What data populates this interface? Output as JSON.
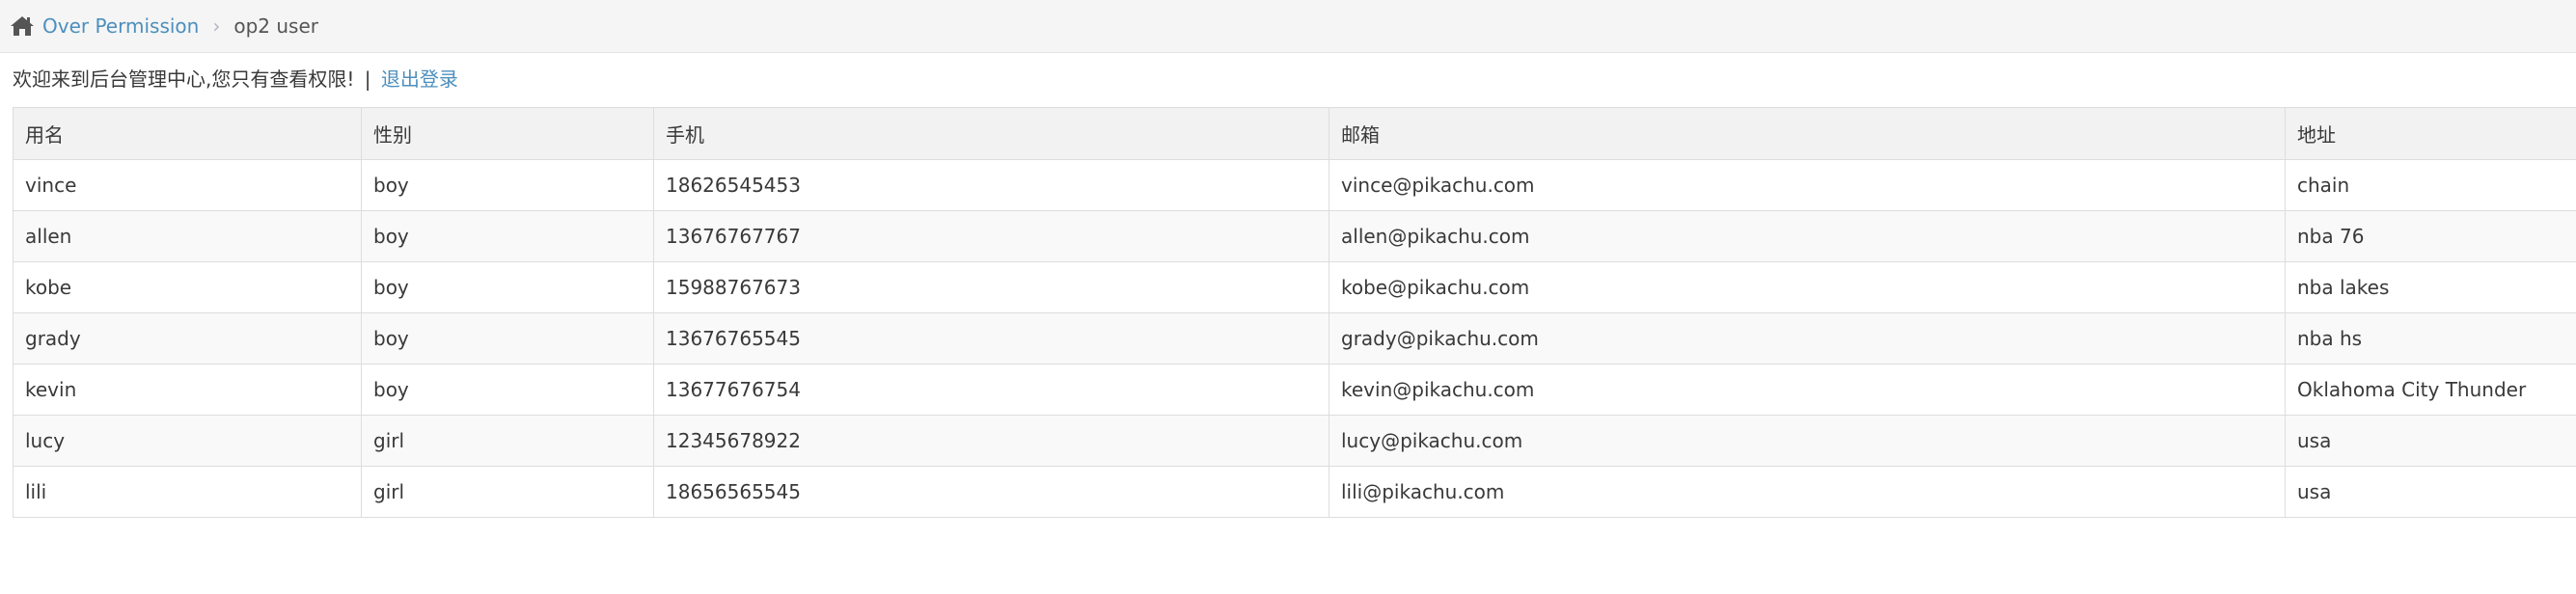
{
  "breadcrumb": {
    "home_icon": "home-icon",
    "parent": "Over Permission",
    "current": "op2 user"
  },
  "welcome": {
    "message": "欢迎来到后台管理中心,您只有查看权限!",
    "separator": "|",
    "logout": "退出登录"
  },
  "table": {
    "headers": [
      "用名",
      "性别",
      "手机",
      "邮箱",
      "地址"
    ],
    "rows": [
      [
        "vince",
        "boy",
        "18626545453",
        "vince@pikachu.com",
        "chain"
      ],
      [
        "allen",
        "boy",
        "13676767767",
        "allen@pikachu.com",
        "nba 76"
      ],
      [
        "kobe",
        "boy",
        "15988767673",
        "kobe@pikachu.com",
        "nba lakes"
      ],
      [
        "grady",
        "boy",
        "13676765545",
        "grady@pikachu.com",
        "nba hs"
      ],
      [
        "kevin",
        "boy",
        "13677676754",
        "kevin@pikachu.com",
        "Oklahoma City Thunder"
      ],
      [
        "lucy",
        "girl",
        "12345678922",
        "lucy@pikachu.com",
        "usa"
      ],
      [
        "lili",
        "girl",
        "18656565545",
        "lili@pikachu.com",
        "usa"
      ]
    ]
  },
  "colors": {
    "link": "#4c8fbd",
    "breadcrumb_bg": "#f5f5f5",
    "header_bg": "#f2f2f2",
    "row_alt_bg": "#f9f9f9",
    "border": "#dddddd"
  }
}
